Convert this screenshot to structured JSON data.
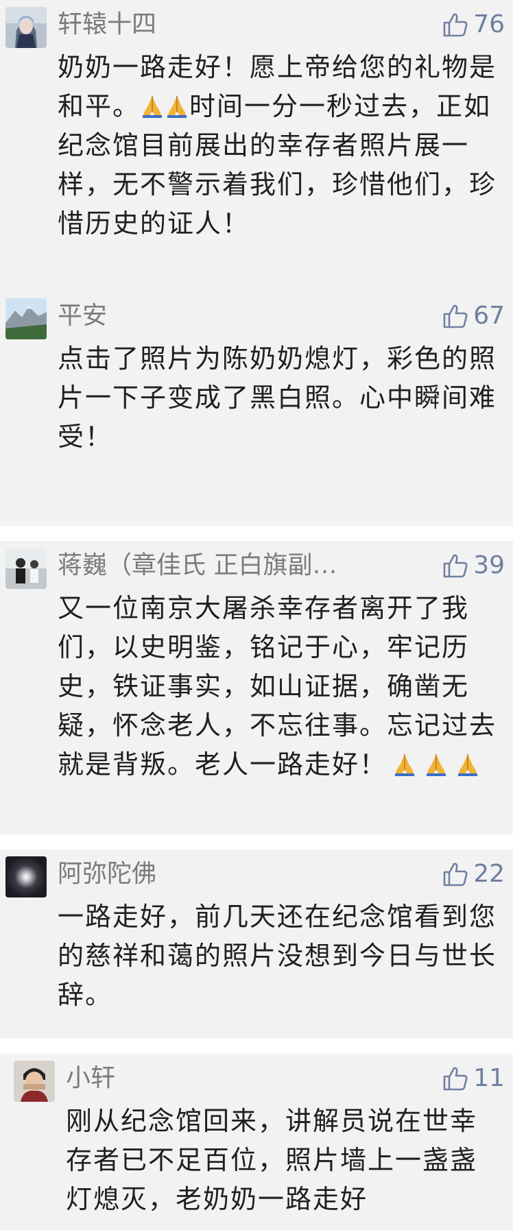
{
  "comments": [
    {
      "author": "轩辕十四",
      "likes": "76",
      "text_a": "奶奶一路走好！愿上帝给您的礼物是和平。",
      "text_b": "时间一分一秒过去，正如纪念馆目前展出的幸存者照片展一样，无不警示着我们，珍惜他们，珍惜历史的证人！"
    },
    {
      "author": "平安",
      "likes": "67",
      "text": "点击了照片为陈奶奶熄灯，彩色的照片一下子变成了黑白照。心中瞬间难受！"
    },
    {
      "author": "蒋巍（章佳氏 正白旗副…",
      "likes": "39",
      "text": "又一位南京大屠杀幸存者离开了我们，以史明鉴，铭记于心，牢记历史，铁证事实，如山证据，确凿无疑，怀念老人，不忘往事。忘记过去就是背叛。老人一路走好！"
    },
    {
      "author": "阿弥陀佛",
      "likes": "22",
      "text": "一路走好，前几天还在纪念馆看到您的慈祥和蔼的照片没想到今日与世长辞。"
    },
    {
      "author": "小轩",
      "likes": "11",
      "text": "刚从纪念馆回来，讲解员说在世幸存者已不足百位，照片墙上一盏盏灯熄灭，老奶奶一路走好"
    }
  ],
  "icons": {
    "like": "thumbs-up-icon",
    "prayer": "folded-hands-emoji"
  },
  "colors": {
    "card_bg": "#f2f2f2",
    "name": "#7b7b7b",
    "like": "#6f7fa0",
    "text": "#1f1f1f",
    "emoji": "#f2b233"
  }
}
